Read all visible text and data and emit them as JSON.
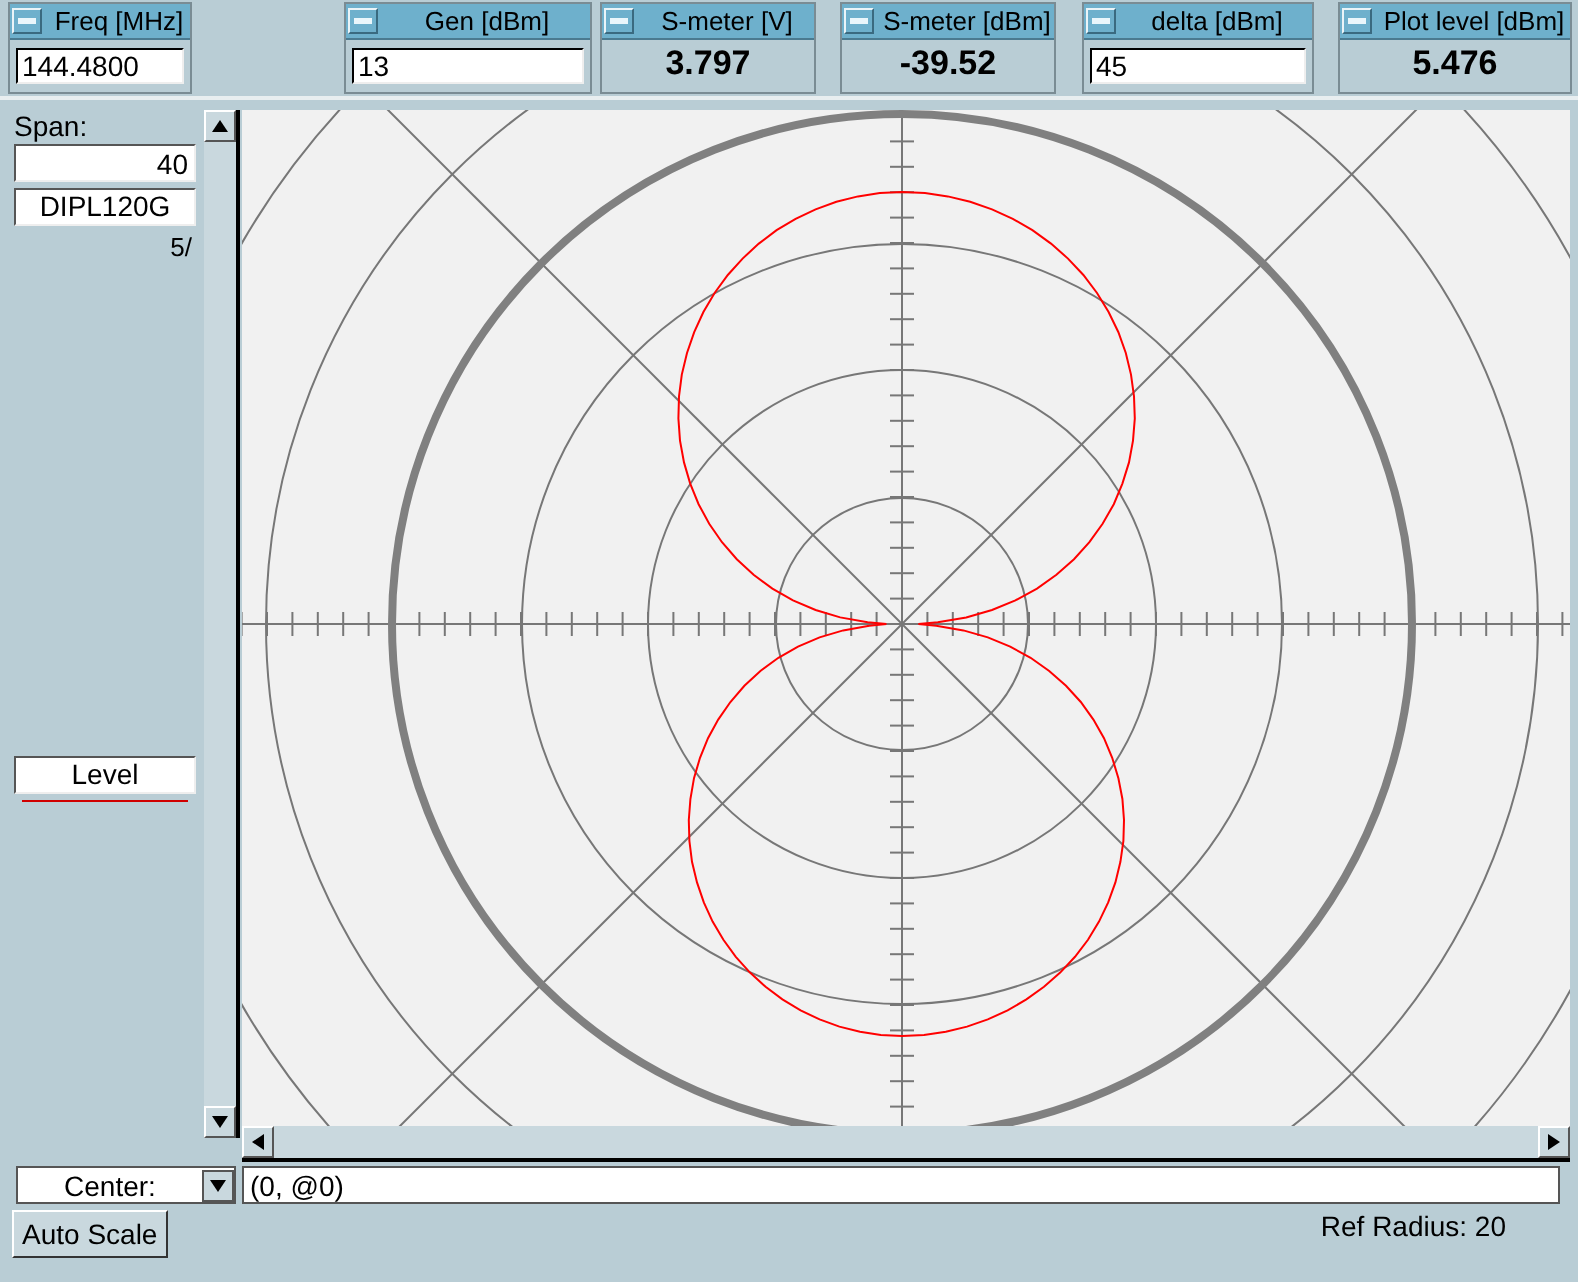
{
  "widgets": [
    {
      "kind": "input",
      "title": "Freq [MHz]",
      "value": "144.4800"
    },
    {
      "kind": "input",
      "title": "Gen [dBm]",
      "value": "13"
    },
    {
      "kind": "readout",
      "title": "S-meter [V]",
      "value": "3.797"
    },
    {
      "kind": "readout",
      "title": "S-meter [dBm]",
      "value": "-39.52"
    },
    {
      "kind": "input",
      "title": "delta [dBm]",
      "value": "45"
    },
    {
      "kind": "readout",
      "title": "Plot level [dBm]",
      "value": "5.476"
    }
  ],
  "side_panel": {
    "span_label": "Span:",
    "span_value": "40",
    "antenna_name": "DIPL120G",
    "scale_note": "5/",
    "level_button": "Level"
  },
  "bottom": {
    "center_select": "Center:",
    "center_value": "(0, @0)",
    "auto_scale_button": "Auto Scale",
    "ref_radius": "Ref Radius: 20"
  }
}
